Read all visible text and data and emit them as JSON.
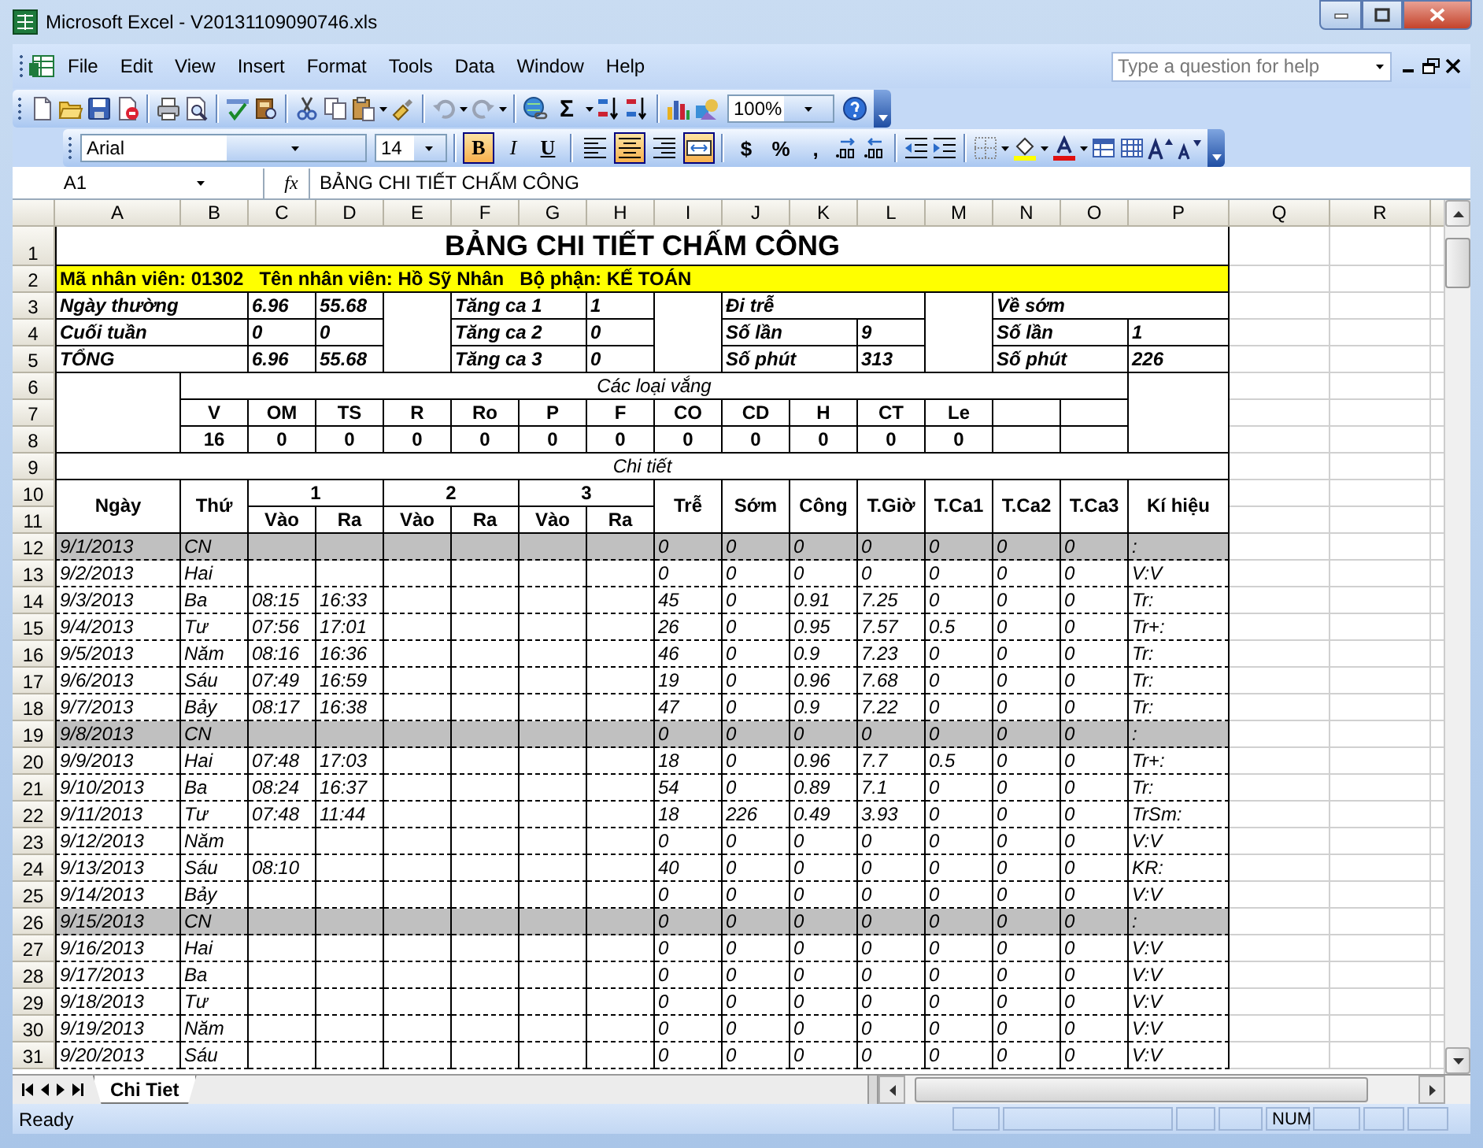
{
  "window": {
    "title": "Microsoft Excel - V20131109090746.xls"
  },
  "menu": [
    "File",
    "Edit",
    "View",
    "Insert",
    "Format",
    "Tools",
    "Data",
    "Window",
    "Help"
  ],
  "help_box": {
    "placeholder": "Type a question for help"
  },
  "standard_toolbar": {
    "sum": "Σ",
    "zoom": "100%"
  },
  "formatting_toolbar": {
    "font": "Arial",
    "size": "14",
    "style_buttons": [
      {
        "label": "B",
        "on": true
      },
      {
        "label": "I",
        "on": false
      },
      {
        "label": "U",
        "on": false
      }
    ],
    "align_buttons": [
      {
        "kind": "left",
        "on": false
      },
      {
        "kind": "center",
        "on": true
      },
      {
        "kind": "right",
        "on": false
      },
      {
        "kind": "merge",
        "on": true
      }
    ],
    "number_buttons": [
      "$",
      "%",
      ","
    ]
  },
  "formula_bar": {
    "name_box": "A1",
    "function_symbol": "fx",
    "formula": "BẢNG CHI TIẾT CHẤM CÔNG"
  },
  "sheet": {
    "columns": [
      "A",
      "B",
      "C",
      "D",
      "E",
      "F",
      "G",
      "H",
      "I",
      "J",
      "K",
      "L",
      "M",
      "N",
      "O",
      "P",
      "Q",
      "R"
    ],
    "rows": [
      "1",
      "2",
      "3",
      "4",
      "5",
      "6",
      "7",
      "8",
      "9",
      "10",
      "11",
      "12",
      "13",
      "14",
      "15",
      "16",
      "17",
      "18",
      "19",
      "20",
      "21",
      "22",
      "23",
      "24",
      "25",
      "26",
      "27",
      "28",
      "29",
      "30",
      "31"
    ],
    "title": "BẢNG CHI TIẾT CHẤM CÔNG",
    "employee": "Mã nhân viên: 01302   Tên nhân viên: Hồ Sỹ Nhân   Bộ phận: KẾ TOÁN",
    "summary": {
      "regular": [
        {
          "label": "Ngày thường",
          "days": "6.96",
          "hours": "55.68"
        },
        {
          "label": "Cuối tuần",
          "days": "0",
          "hours": "0"
        },
        {
          "label": "TỔNG",
          "days": "6.96",
          "hours": "55.68"
        }
      ],
      "overtime": [
        {
          "label": "Tăng ca 1",
          "value": "1"
        },
        {
          "label": "Tăng ca 2",
          "value": "0"
        },
        {
          "label": "Tăng ca 3",
          "value": "0"
        }
      ],
      "late": {
        "title": "Đi trễ",
        "rows": [
          {
            "label": "Số lần",
            "value": "9"
          },
          {
            "label": "Số phút",
            "value": "313"
          }
        ]
      },
      "early": {
        "title": "Về sớm",
        "rows": [
          {
            "label": "Số lần",
            "value": "1"
          },
          {
            "label": "Số phút",
            "value": "226"
          }
        ]
      }
    },
    "absence": {
      "title": "Các loại vắng",
      "types": [
        {
          "code": "V",
          "count": "16"
        },
        {
          "code": "OM",
          "count": "0"
        },
        {
          "code": "TS",
          "count": "0"
        },
        {
          "code": "R",
          "count": "0"
        },
        {
          "code": "Ro",
          "count": "0"
        },
        {
          "code": "P",
          "count": "0"
        },
        {
          "code": "F",
          "count": "0"
        },
        {
          "code": "CO",
          "count": "0"
        },
        {
          "code": "CD",
          "count": "0"
        },
        {
          "code": "H",
          "count": "0"
        },
        {
          "code": "CT",
          "count": "0"
        },
        {
          "code": "Le",
          "count": "0"
        }
      ]
    },
    "detail": {
      "title": "Chi tiết",
      "date_header": "Ngày",
      "weekday_header": "Thứ",
      "shifts": [
        {
          "label": "1",
          "in": "Vào",
          "out": "Ra"
        },
        {
          "label": "2",
          "in": "Vào",
          "out": "Ra"
        },
        {
          "label": "3",
          "in": "Vào",
          "out": "Ra"
        }
      ],
      "stat_headers": [
        "Trễ",
        "Sớm",
        "Công",
        "T.Giờ",
        "T.Ca1",
        "T.Ca2",
        "T.Ca3",
        "Kí hiệu"
      ],
      "rows": [
        {
          "date": "9/1/2013",
          "weekday": "CN",
          "late": "0",
          "early": "0",
          "work": "0",
          "hours": "0",
          "ot_1": "0",
          "ot_2": "0",
          "ot_3": "0",
          "code": ":",
          "weekend": true
        },
        {
          "date": "9/2/2013",
          "weekday": "Hai",
          "late": "0",
          "early": "0",
          "work": "0",
          "hours": "0",
          "ot_1": "0",
          "ot_2": "0",
          "ot_3": "0",
          "code": "V:V",
          "weekend": false
        },
        {
          "date": "9/3/2013",
          "weekday": "Ba",
          "in_1": "08:15",
          "out_1": "16:33",
          "late": "45",
          "early": "0",
          "work": "0.91",
          "hours": "7.25",
          "ot_1": "0",
          "ot_2": "0",
          "ot_3": "0",
          "code": "Tr:",
          "weekend": false
        },
        {
          "date": "9/4/2013",
          "weekday": "Tư",
          "in_1": "07:56",
          "out_1": "17:01",
          "late": "26",
          "early": "0",
          "work": "0.95",
          "hours": "7.57",
          "ot_1": "0.5",
          "ot_2": "0",
          "ot_3": "0",
          "code": "Tr+:",
          "weekend": false
        },
        {
          "date": "9/5/2013",
          "weekday": "Năm",
          "in_1": "08:16",
          "out_1": "16:36",
          "late": "46",
          "early": "0",
          "work": "0.9",
          "hours": "7.23",
          "ot_1": "0",
          "ot_2": "0",
          "ot_3": "0",
          "code": "Tr:",
          "weekend": false
        },
        {
          "date": "9/6/2013",
          "weekday": "Sáu",
          "in_1": "07:49",
          "out_1": "16:59",
          "late": "19",
          "early": "0",
          "work": "0.96",
          "hours": "7.68",
          "ot_1": "0",
          "ot_2": "0",
          "ot_3": "0",
          "code": "Tr:",
          "weekend": false
        },
        {
          "date": "9/7/2013",
          "weekday": "Bảy",
          "in_1": "08:17",
          "out_1": "16:38",
          "late": "47",
          "early": "0",
          "work": "0.9",
          "hours": "7.22",
          "ot_1": "0",
          "ot_2": "0",
          "ot_3": "0",
          "code": "Tr:",
          "weekend": false
        },
        {
          "date": "9/8/2013",
          "weekday": "CN",
          "late": "0",
          "early": "0",
          "work": "0",
          "hours": "0",
          "ot_1": "0",
          "ot_2": "0",
          "ot_3": "0",
          "code": ":",
          "weekend": true
        },
        {
          "date": "9/9/2013",
          "weekday": "Hai",
          "in_1": "07:48",
          "out_1": "17:03",
          "late": "18",
          "early": "0",
          "work": "0.96",
          "hours": "7.7",
          "ot_1": "0.5",
          "ot_2": "0",
          "ot_3": "0",
          "code": "Tr+:",
          "weekend": false
        },
        {
          "date": "9/10/2013",
          "weekday": "Ba",
          "in_1": "08:24",
          "out_1": "16:37",
          "late": "54",
          "early": "0",
          "work": "0.89",
          "hours": "7.1",
          "ot_1": "0",
          "ot_2": "0",
          "ot_3": "0",
          "code": "Tr:",
          "weekend": false
        },
        {
          "date": "9/11/2013",
          "weekday": "Tư",
          "in_1": "07:48",
          "out_1": "11:44",
          "late": "18",
          "early": "226",
          "work": "0.49",
          "hours": "3.93",
          "ot_1": "0",
          "ot_2": "0",
          "ot_3": "0",
          "code": "TrSm:",
          "weekend": false
        },
        {
          "date": "9/12/2013",
          "weekday": "Năm",
          "late": "0",
          "early": "0",
          "work": "0",
          "hours": "0",
          "ot_1": "0",
          "ot_2": "0",
          "ot_3": "0",
          "code": "V:V",
          "weekend": false
        },
        {
          "date": "9/13/2013",
          "weekday": "Sáu",
          "in_1": "08:10",
          "late": "40",
          "early": "0",
          "work": "0",
          "hours": "0",
          "ot_1": "0",
          "ot_2": "0",
          "ot_3": "0",
          "code": "KR:",
          "weekend": false
        },
        {
          "date": "9/14/2013",
          "weekday": "Bảy",
          "late": "0",
          "early": "0",
          "work": "0",
          "hours": "0",
          "ot_1": "0",
          "ot_2": "0",
          "ot_3": "0",
          "code": "V:V",
          "weekend": false
        },
        {
          "date": "9/15/2013",
          "weekday": "CN",
          "late": "0",
          "early": "0",
          "work": "0",
          "hours": "0",
          "ot_1": "0",
          "ot_2": "0",
          "ot_3": "0",
          "code": ":",
          "weekend": true
        },
        {
          "date": "9/16/2013",
          "weekday": "Hai",
          "late": "0",
          "early": "0",
          "work": "0",
          "hours": "0",
          "ot_1": "0",
          "ot_2": "0",
          "ot_3": "0",
          "code": "V:V",
          "weekend": false
        },
        {
          "date": "9/17/2013",
          "weekday": "Ba",
          "late": "0",
          "early": "0",
          "work": "0",
          "hours": "0",
          "ot_1": "0",
          "ot_2": "0",
          "ot_3": "0",
          "code": "V:V",
          "weekend": false
        },
        {
          "date": "9/18/2013",
          "weekday": "Tư",
          "late": "0",
          "early": "0",
          "work": "0",
          "hours": "0",
          "ot_1": "0",
          "ot_2": "0",
          "ot_3": "0",
          "code": "V:V",
          "weekend": false
        },
        {
          "date": "9/19/2013",
          "weekday": "Năm",
          "late": "0",
          "early": "0",
          "work": "0",
          "hours": "0",
          "ot_1": "0",
          "ot_2": "0",
          "ot_3": "0",
          "code": "V:V",
          "weekend": false
        },
        {
          "date": "9/20/2013",
          "weekday": "Sáu",
          "late": "0",
          "early": "0",
          "work": "0",
          "hours": "0",
          "ot_1": "0",
          "ot_2": "0",
          "ot_3": "0",
          "code": "V:V",
          "weekend": false
        }
      ]
    }
  },
  "sheet_tabs": [
    {
      "label": "Chi Tiet",
      "selected": true
    }
  ],
  "status_bar": {
    "text": "Ready",
    "num": "NUM"
  }
}
